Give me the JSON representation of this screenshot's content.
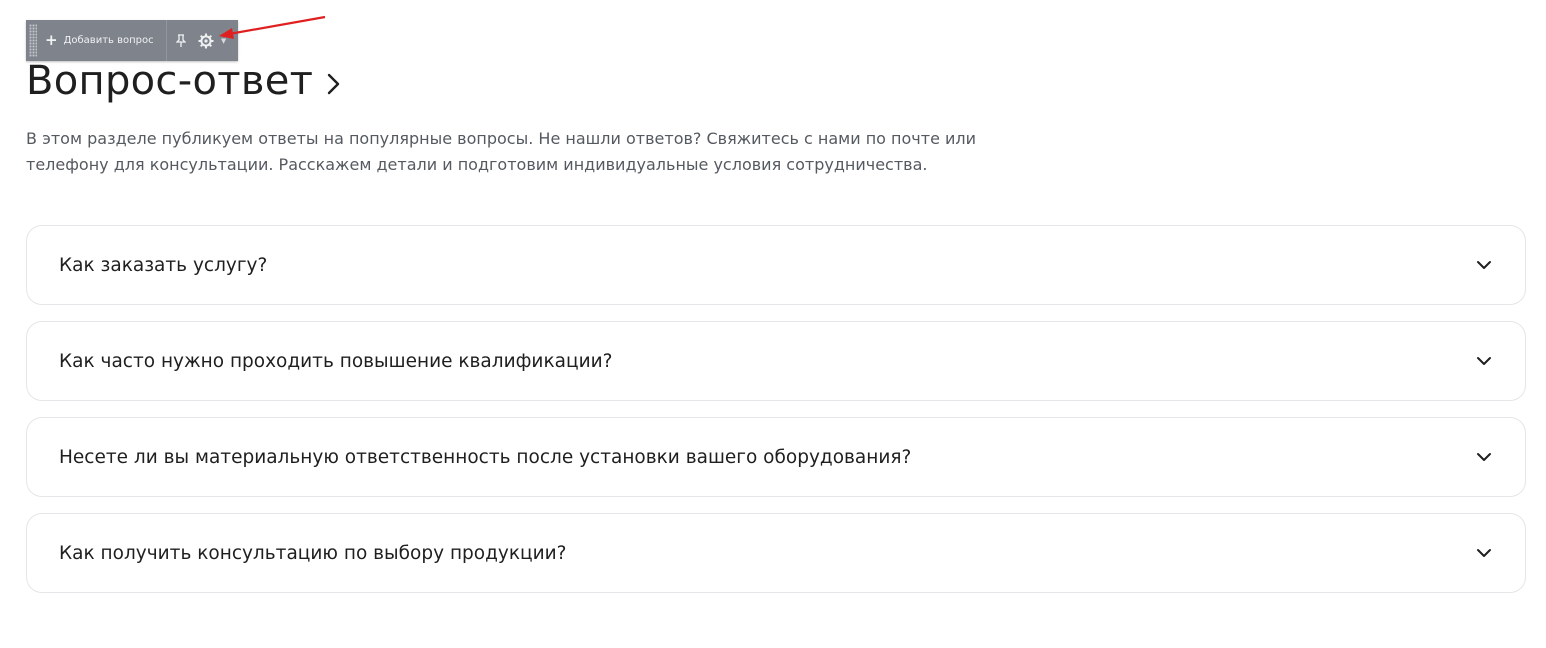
{
  "toolbar": {
    "add_label": "Добавить вопрос",
    "add_icon": "plus-icon",
    "pin_icon": "pin-icon",
    "settings_icon": "gear-icon",
    "menu_icon": "caret-down-icon"
  },
  "header": {
    "title": "Вопрос-ответ",
    "title_icon": "chevron-right-icon"
  },
  "intro": {
    "text": "В этом разделе публикуем ответы на популярные вопросы. Не нашли ответов? Свяжитесь с нами по почте или телефону для консультации. Расскажем детали и подготовим индивидуальные условия сотрудничества."
  },
  "faq": {
    "items": [
      {
        "question": "Как заказать услугу?"
      },
      {
        "question": "Как часто нужно проходить повышение квалификации?"
      },
      {
        "question": "Несете ли вы материальную ответственность после установки вашего оборудования?"
      },
      {
        "question": "Как получить консультацию по выбору продукции?"
      }
    ]
  },
  "colors": {
    "toolbar_bg": "#7f838b",
    "annotation_arrow": "#e02020",
    "card_border": "#e4e6e9"
  }
}
